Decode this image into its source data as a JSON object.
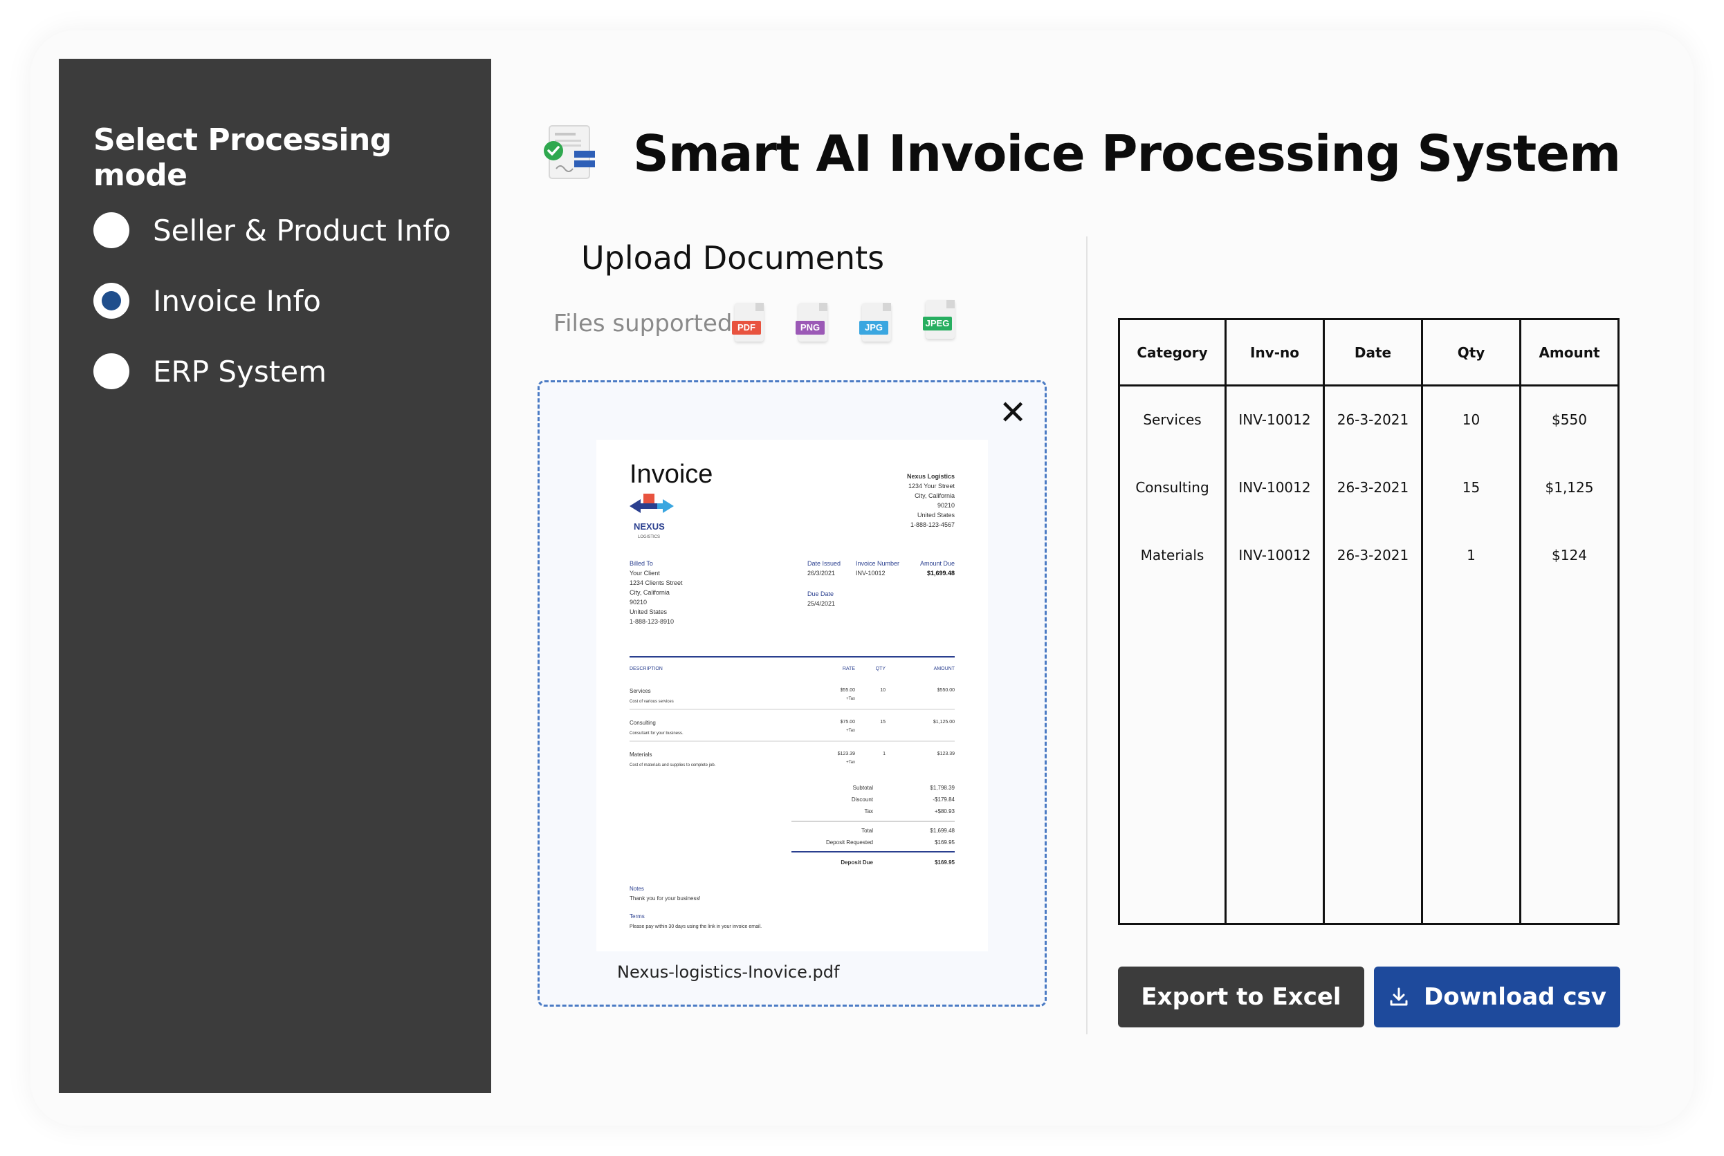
{
  "sidebar": {
    "title": "Select Processing mode",
    "modes": [
      {
        "label": "Seller & Product Info",
        "selected": false
      },
      {
        "label": "Invoice Info",
        "selected": true
      },
      {
        "label": "ERP System",
        "selected": false
      }
    ]
  },
  "header": {
    "title": "Smart AI Invoice Processing System",
    "icon": "invoice-check-icon"
  },
  "upload": {
    "title": "Upload Documents",
    "files_label": "Files supported:",
    "file_types": [
      {
        "label": "PDF",
        "color": "#e8533f"
      },
      {
        "label": "PNG",
        "color": "#9b59b6"
      },
      {
        "label": "JPG",
        "color": "#3aa6e0"
      },
      {
        "label": "JPEG",
        "color": "#27ae60"
      }
    ],
    "close_icon": "close-icon",
    "filename": "Nexus-logistics-Inovice.pdf"
  },
  "invoice_preview": {
    "title": "Invoice",
    "company": "NEXUS",
    "company_sub": "LOGISTICS",
    "from_lines": [
      "Nexus Logistics",
      "1234 Your Street",
      "City, California",
      "90210",
      "United States",
      "1-888-123-4567"
    ],
    "billed_to_label": "Billed To",
    "billed_to_lines": [
      "Your Client",
      "1234 Clients Street",
      "City, California",
      "90210",
      "United States",
      "1-888-123-8910"
    ],
    "date_issued_label": "Date Issued",
    "date_issued": "26/3/2021",
    "invoice_number_label": "Invoice Number",
    "invoice_number": "INV-10012",
    "amount_due_label": "Amount Due",
    "amount_due": "$1,699.48",
    "due_date_label": "Due Date",
    "due_date": "25/4/2021",
    "columns": [
      "DESCRIPTION",
      "RATE",
      "QTY",
      "AMOUNT"
    ],
    "items": [
      {
        "name": "Services",
        "desc": "Cost of various services",
        "rate": "$55.00",
        "tax": "+Tax",
        "qty": "10",
        "amount": "$550.00"
      },
      {
        "name": "Consulting",
        "desc": "Consultant for your business.",
        "rate": "$75.00",
        "tax": "+Tax",
        "qty": "15",
        "amount": "$1,125.00"
      },
      {
        "name": "Materials",
        "desc": "Cost of materials and supplies to complete job.",
        "rate": "$123.39",
        "tax": "+Tax",
        "qty": "1",
        "amount": "$123.39"
      }
    ],
    "totals": [
      {
        "label": "Subtotal",
        "value": "$1,798.39"
      },
      {
        "label": "Discount",
        "value": "-$179.84"
      },
      {
        "label": "Tax",
        "value": "+$80.93"
      },
      {
        "label": "Total",
        "value": "$1,699.48"
      },
      {
        "label": "Deposit Requested",
        "value": "$169.95"
      },
      {
        "label": "Deposit Due",
        "value": "$169.95"
      }
    ],
    "notes_label": "Notes",
    "notes": "Thank you for your business!",
    "terms_label": "Terms",
    "terms": "Please pay within 30 days using the link in your invoice email."
  },
  "result_table": {
    "headers": [
      "Category",
      "Inv-no",
      "Date",
      "Qty",
      "Amount"
    ],
    "rows": [
      [
        "Services",
        "INV-10012",
        "26-3-2021",
        "10",
        "$550"
      ],
      [
        "Consulting",
        "INV-10012",
        "26-3-2021",
        "15",
        "$1,125"
      ],
      [
        "Materials",
        "INV-10012",
        "26-3-2021",
        "1",
        "$124"
      ]
    ]
  },
  "actions": {
    "export_label": "Export to Excel",
    "download_label": "Download csv",
    "download_icon": "download-icon"
  },
  "colors": {
    "sidebar_bg": "#3c3c3c",
    "radio_selected": "#1f4e8c",
    "download_button": "#1e4a9c",
    "export_button": "#3c3c3c",
    "dropzone_border": "#4b7bc4"
  }
}
